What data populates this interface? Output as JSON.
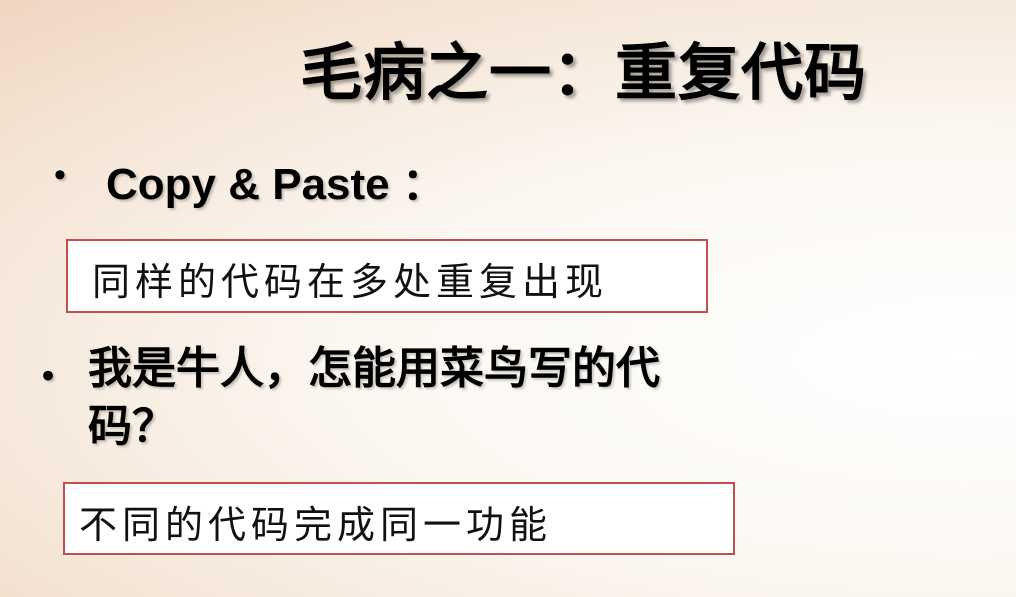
{
  "slide": {
    "title": "毛病之一：重复代码",
    "bullets": [
      {
        "marker": "•",
        "text": "Copy & Paste ："
      },
      {
        "marker": "•",
        "text": "我是牛人，怎能用菜鸟写的代码？"
      }
    ],
    "boxes": [
      {
        "text": "同样的代码在多处重复出现"
      },
      {
        "text": "不同的代码完成同一功能"
      }
    ],
    "colors": {
      "box_border": "#c0504d",
      "box_background": "#ffffff",
      "text": "#000000"
    }
  }
}
